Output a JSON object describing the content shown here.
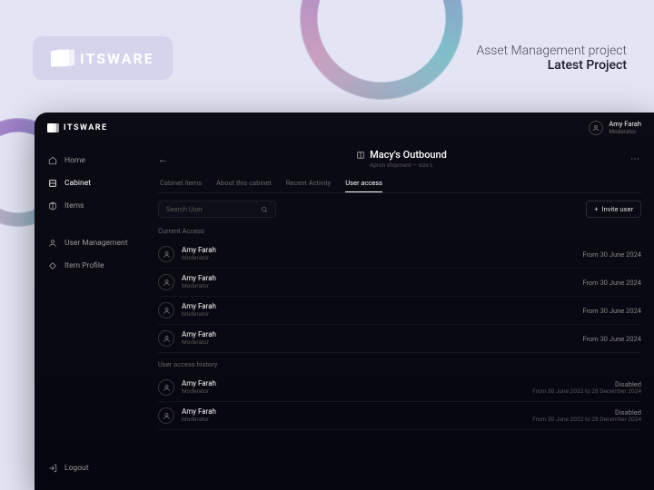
{
  "marketing": {
    "brand": "ITSWARE",
    "project_type": "Asset Management project",
    "project_label": "Latest Project"
  },
  "app": {
    "brand": "ITSWARE",
    "current_user": {
      "name": "Amy Farah",
      "role": "Moderator"
    }
  },
  "sidebar": {
    "items": [
      {
        "label": "Home"
      },
      {
        "label": "Cabinet"
      },
      {
        "label": "Items"
      },
      {
        "label": "User Management"
      },
      {
        "label": "Item Profile"
      }
    ],
    "logout_label": "Logout"
  },
  "page": {
    "title": "Macy's Outbound",
    "subtitle": "Apron shipment – size L",
    "tabs": [
      "Cabinet items",
      "About this cabinet",
      "Recent Activity",
      "User access"
    ],
    "search_placeholder": "Search User",
    "invite_label": "Invite user",
    "sections": {
      "current": "Current Access",
      "history": "User access history"
    },
    "current_access": [
      {
        "name": "Amy Farah",
        "role": "Moderator",
        "since": "From 30 June 2024"
      },
      {
        "name": "Amy Farah",
        "role": "Moderator",
        "since": "From 30 June 2024"
      },
      {
        "name": "Amy Farah",
        "role": "Moderator",
        "since": "From 30 June 2024"
      },
      {
        "name": "Amy Farah",
        "role": "Moderator",
        "since": "From 30 June 2024"
      }
    ],
    "history": [
      {
        "name": "Amy Farah",
        "role": "Moderator",
        "status": "Disabled",
        "range": "From 30 June 2022 to 28 December 2024"
      },
      {
        "name": "Amy Farah",
        "role": "Moderator",
        "status": "Disabled",
        "range": "From 30 June 2022 to 28 December 2024"
      }
    ]
  }
}
